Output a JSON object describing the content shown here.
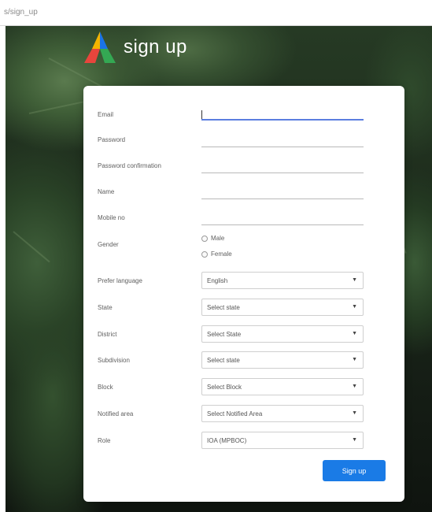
{
  "browser": {
    "url": "s/sign_up"
  },
  "brand": {
    "title": "sign up"
  },
  "form": {
    "email_label": "Email",
    "password_label": "Password",
    "password_confirmation_label": "Password confirmation",
    "name_label": "Name",
    "mobile_label": "Mobile no",
    "gender": {
      "label": "Gender",
      "options": [
        "Male",
        "Female"
      ]
    },
    "prefer_language": {
      "label": "Prefer language",
      "value": "English"
    },
    "state": {
      "label": "State",
      "value": "Select state"
    },
    "district": {
      "label": "District",
      "value": "Select State"
    },
    "subdivision": {
      "label": "Subdivision",
      "value": "Select state"
    },
    "block": {
      "label": "Block",
      "value": "Select Block"
    },
    "notified_area": {
      "label": "Notified area",
      "value": "Select Notified Area"
    },
    "role": {
      "label": "Role",
      "value": "IOA (MPBOC)"
    },
    "submit_label": "Sign up"
  },
  "colors": {
    "accent": "#1a7be6",
    "focus_underline": "#5b7ee0",
    "logo_yellow": "#f5b400",
    "logo_red": "#e8453c",
    "logo_blue": "#1a73e8",
    "logo_green": "#34a853"
  },
  "icons": {
    "logo": "triangle-logo-icon",
    "select_arrow": "triangle-down-icon"
  }
}
